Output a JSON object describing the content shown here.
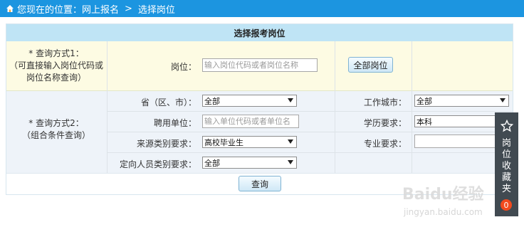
{
  "breadcrumb": {
    "location_label": "您现在的位置：网上报名",
    "separator": ">",
    "current": "选择岗位"
  },
  "panel": {
    "title": "选择报考岗位"
  },
  "mode1": {
    "label_line1": "* 查询方式1：",
    "label_line2": "（可直接输入岗位代码或",
    "label_line3": "岗位名称查询）",
    "position_label": "岗位：",
    "position_placeholder": "输入岗位代码或者岗位名称",
    "all_positions_button": "全部岗位"
  },
  "mode2": {
    "label_line1": "* 查询方式2：",
    "label_line2": "（组合条件查询）",
    "province_label": "省（区、市）：",
    "province_value": "全部",
    "employer_label": "聘用单位：",
    "employer_placeholder": "输入单位代码或者单位名",
    "source_label": "来源类别要求：",
    "source_value": "高校毕业生",
    "directed_label": "定向人员类别要求：",
    "directed_value": "全部",
    "city_label": "工作城市：",
    "city_value": "全部",
    "education_label": "学历要求：",
    "education_value": "本科",
    "major_label": "专业要求：",
    "major_value": ""
  },
  "query_button": "查询",
  "favorites": {
    "label": "岗位收藏夹",
    "count": "0",
    "icon": "star-icon"
  },
  "watermark": {
    "brand": "Baidu经验",
    "url": "jingyan.baidu.com"
  },
  "colors": {
    "topbar": "#1c95e0",
    "title_bg": "#bfe4f5",
    "row1_bg": "#fdfbe3",
    "row2_bg": "#eef3f9",
    "favorites_bg": "#414a51",
    "badge": "#f24a1d"
  }
}
